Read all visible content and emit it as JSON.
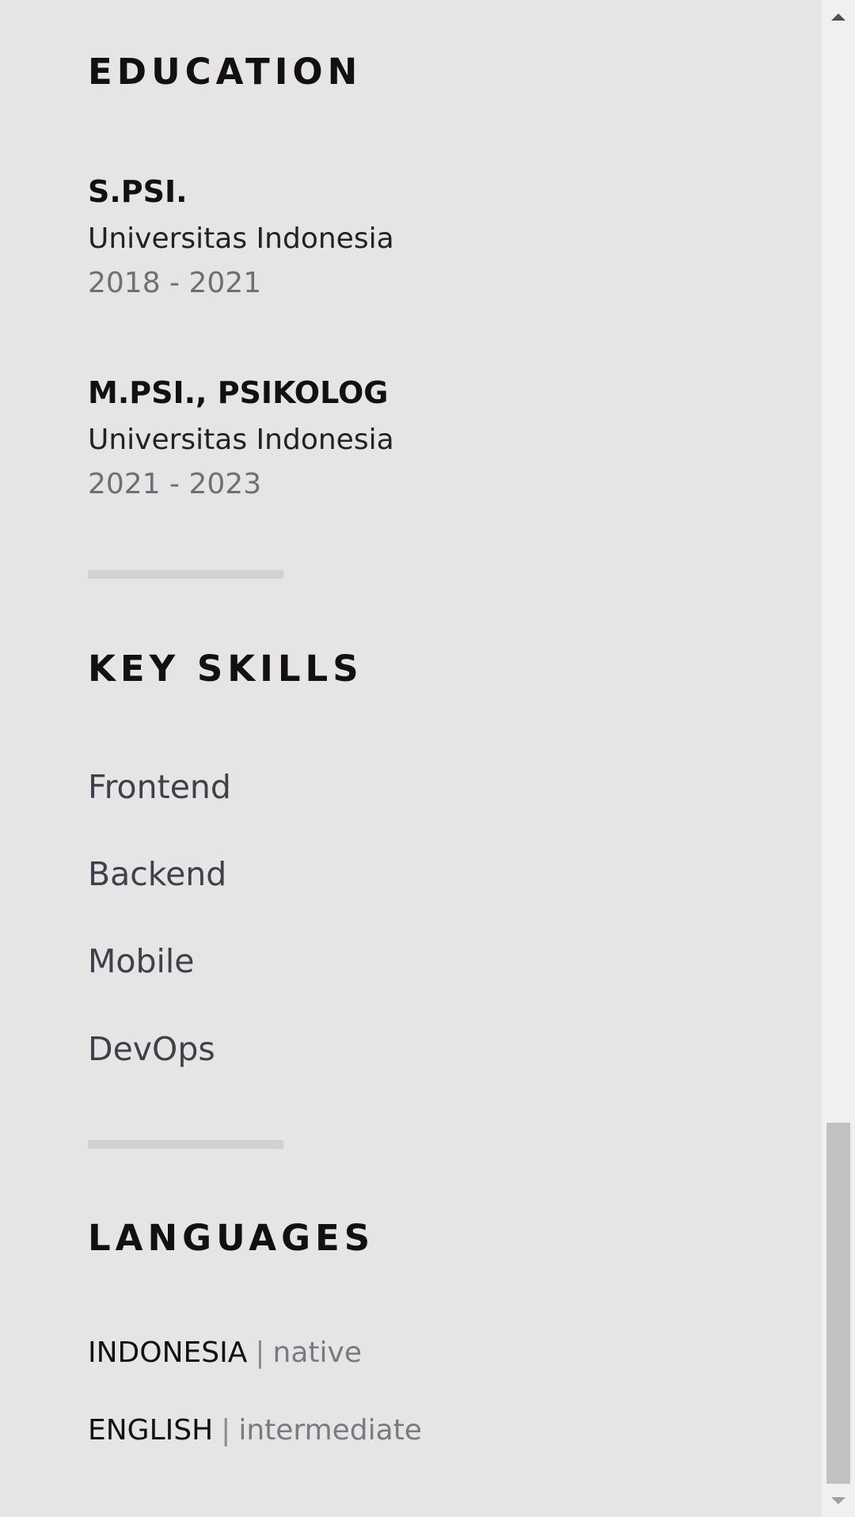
{
  "education": {
    "heading": "EDUCATION",
    "entries": [
      {
        "degree": "S.PSI.",
        "school": "Universitas Indonesia",
        "years": "2018 - 2021"
      },
      {
        "degree": "M.PSI., PSIKOLOG",
        "school": "Universitas Indonesia",
        "years": "2021 - 2023"
      }
    ]
  },
  "skills": {
    "heading": "KEY SKILLS",
    "items": [
      "Frontend",
      "Backend",
      "Mobile",
      "DevOps"
    ]
  },
  "languages": {
    "heading": "LANGUAGES",
    "separator": "|",
    "items": [
      {
        "name": "INDONESIA",
        "level": "native"
      },
      {
        "name": "ENGLISH",
        "level": "intermediate"
      }
    ]
  },
  "scrollbar": {
    "up_icon": "triangle-up",
    "down_icon": "triangle-down",
    "thumb_color": "#c1c1c1"
  }
}
